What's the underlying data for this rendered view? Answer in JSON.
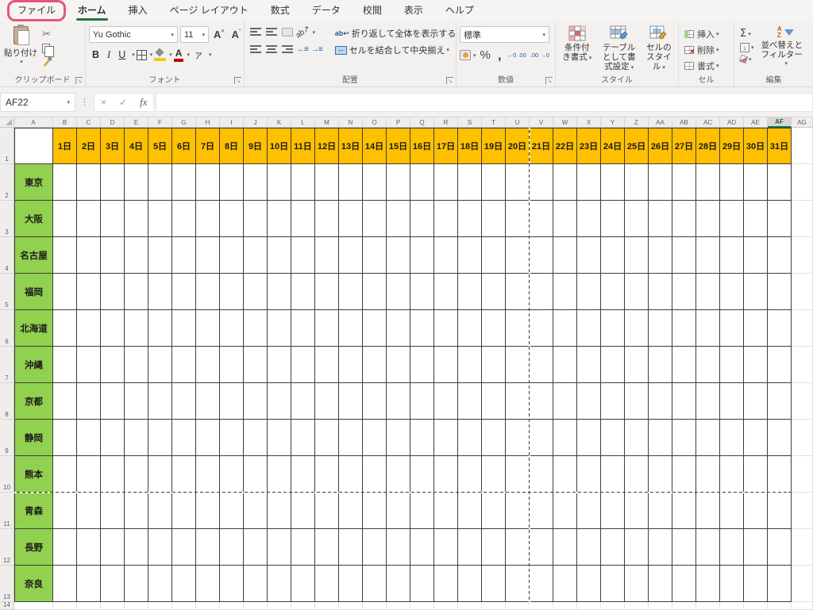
{
  "tabs": {
    "items": [
      {
        "id": "file",
        "label": "ファイル",
        "active": false,
        "highlighted": true
      },
      {
        "id": "home",
        "label": "ホーム",
        "active": true,
        "highlighted": false
      },
      {
        "id": "insert",
        "label": "挿入",
        "active": false,
        "highlighted": false
      },
      {
        "id": "page-layout",
        "label": "ページ レイアウト",
        "active": false,
        "highlighted": false
      },
      {
        "id": "formulas",
        "label": "数式",
        "active": false,
        "highlighted": false
      },
      {
        "id": "data",
        "label": "データ",
        "active": false,
        "highlighted": false
      },
      {
        "id": "review",
        "label": "校閲",
        "active": false,
        "highlighted": false
      },
      {
        "id": "view",
        "label": "表示",
        "active": false,
        "highlighted": false
      },
      {
        "id": "help",
        "label": "ヘルプ",
        "active": false,
        "highlighted": false
      }
    ]
  },
  "ribbon": {
    "clipboard": {
      "group_label": "クリップボード",
      "paste_label": "貼り付け"
    },
    "font": {
      "group_label": "フォント",
      "family": "Yu Gothic",
      "size": "11",
      "bold": "B",
      "italic": "I",
      "underline": "U",
      "grow": "A",
      "shrink": "A",
      "fontcolor": "A",
      "phonetic": "ア"
    },
    "alignment": {
      "group_label": "配置",
      "wrap_label": "折り返して全体を表示する",
      "merge_label": "セルを結合して中央揃え",
      "wrap_icon": "ab",
      "orient_icon": "ab",
      "indent_out": "←≡",
      "indent_in": "→≡"
    },
    "number": {
      "group_label": "数値",
      "format": "標準",
      "percent": "%",
      "comma": ",",
      "inc_decimal": "←0 .00",
      "dec_decimal": ".00 →0"
    },
    "styles": {
      "group_label": "スタイル",
      "conditional_label": "条件付き書式",
      "table_label": "テーブルとして書式設定",
      "cellstyles_label": "セルのスタイル"
    },
    "cells": {
      "group_label": "セル",
      "insert_label": "挿入",
      "delete_label": "削除",
      "format_label": "書式"
    },
    "editing": {
      "group_label": "編集",
      "autosum": "Σ",
      "filldown": "↓",
      "sort_label": "並べ替えとフィルター",
      "sort_a": "A",
      "sort_z": "Z"
    }
  },
  "formula_bar": {
    "name_box": "AF22",
    "cancel": "×",
    "enter": "✓",
    "fx": "fx",
    "input_value": ""
  },
  "grid": {
    "selected_column": "AF",
    "column_letters": [
      "A",
      "B",
      "C",
      "D",
      "E",
      "F",
      "G",
      "H",
      "I",
      "J",
      "K",
      "L",
      "M",
      "N",
      "O",
      "P",
      "Q",
      "R",
      "S",
      "T",
      "U",
      "V",
      "W",
      "X",
      "Y",
      "Z",
      "AA",
      "AB",
      "AC",
      "AD",
      "AE",
      "AF",
      "AG"
    ],
    "day_headers": [
      "1日",
      "2日",
      "3日",
      "4日",
      "5日",
      "6日",
      "7日",
      "8日",
      "9日",
      "10日",
      "11日",
      "12日",
      "13日",
      "14日",
      "15日",
      "16日",
      "17日",
      "18日",
      "19日",
      "20日",
      "21日",
      "22日",
      "23日",
      "24日",
      "25日",
      "26日",
      "27日",
      "28日",
      "29日",
      "30日",
      "31日"
    ],
    "row_numbers": [
      "1",
      "2",
      "3",
      "4",
      "5",
      "6",
      "7",
      "8",
      "9",
      "10",
      "11",
      "12",
      "13",
      "14"
    ],
    "cities": [
      "東京",
      "大阪",
      "名古屋",
      "福岡",
      "北海道",
      "沖縄",
      "京都",
      "静岡",
      "熊本",
      "青森",
      "長野",
      "奈良"
    ]
  },
  "colors": {
    "day_fill": "#FFC000",
    "city_fill": "#92D050",
    "accent_green": "#217346",
    "annotation_pink": "#E8537C",
    "table_border": "#3D3D3D"
  }
}
